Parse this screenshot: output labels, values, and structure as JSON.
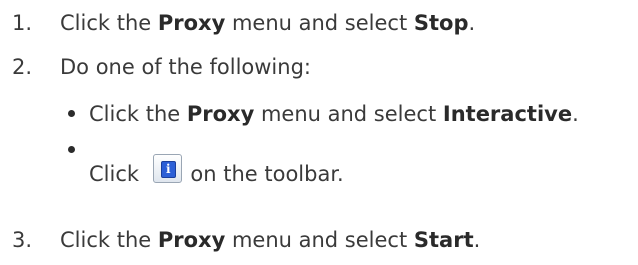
{
  "steps": [
    {
      "number": "1.",
      "pre": "Click the ",
      "menu": "Proxy",
      "mid": " menu and select ",
      "item": "Stop",
      "post": "."
    },
    {
      "number": "2.",
      "text": "Do one of the following:"
    },
    {
      "number": "3.",
      "pre": "Click the ",
      "menu": "Proxy",
      "mid": " menu and select ",
      "item": "Start",
      "post": "."
    }
  ],
  "options": [
    {
      "pre": "Click the ",
      "menu": "Proxy",
      "mid": " menu and select ",
      "item": "Interactive",
      "post": "."
    },
    {
      "pre": "Click ",
      "post": " on the toolbar.",
      "icon": "interactive-info-icon",
      "icon_glyph": "i",
      "icon_color": "#2c5fd6"
    }
  ]
}
